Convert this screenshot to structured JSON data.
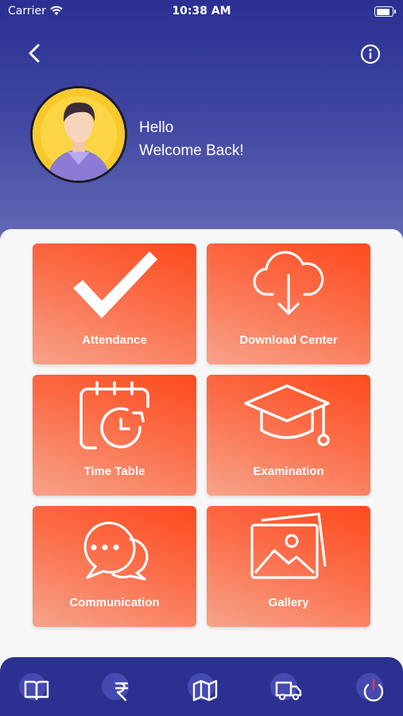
{
  "status_bar": {
    "carrier": "Carrier",
    "time": "10:38 AM"
  },
  "header": {
    "back_icon": "chevron-left-icon",
    "info_icon": "info-circle-icon",
    "greeting_line1": "Hello",
    "greeting_line2": "Welcome Back!"
  },
  "tiles": [
    {
      "label": "Attendance",
      "icon": "checkmark-icon"
    },
    {
      "label": "Download Center",
      "icon": "cloud-download-icon"
    },
    {
      "label": "Time Table",
      "icon": "calendar-clock-icon"
    },
    {
      "label": "Examination",
      "icon": "graduation-cap-icon"
    },
    {
      "label": "Communication",
      "icon": "chat-bubbles-icon"
    },
    {
      "label": "Gallery",
      "icon": "image-gallery-icon"
    }
  ],
  "bottom_nav": [
    {
      "icon": "book-icon"
    },
    {
      "icon": "rupee-icon"
    },
    {
      "icon": "map-icon"
    },
    {
      "icon": "truck-icon"
    },
    {
      "icon": "power-icon"
    }
  ],
  "colors": {
    "header_top": "#2b3092",
    "tile_orange": "#ff4a1c",
    "nav_bg": "#2c3090"
  }
}
